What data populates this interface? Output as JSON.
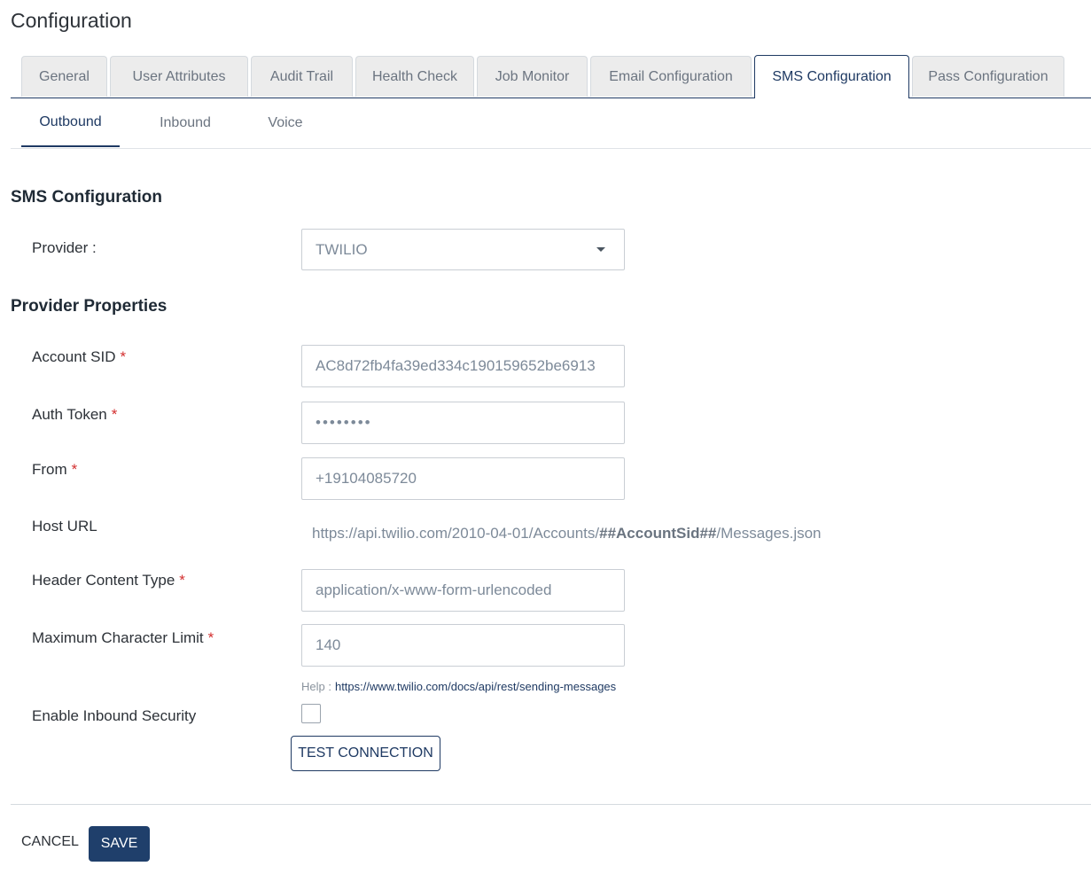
{
  "page": {
    "title": "Configuration"
  },
  "main_tabs": [
    {
      "label": "General"
    },
    {
      "label": "User Attributes"
    },
    {
      "label": "Audit Trail"
    },
    {
      "label": "Health Check"
    },
    {
      "label": "Job Monitor"
    },
    {
      "label": "Email Configuration"
    },
    {
      "label": "SMS Configuration"
    },
    {
      "label": "Pass Configuration"
    }
  ],
  "active_main_tab": "SMS Configuration",
  "sub_tabs": [
    {
      "label": "Outbound"
    },
    {
      "label": "Inbound"
    },
    {
      "label": "Voice"
    }
  ],
  "active_sub_tab": "Outbound",
  "sms_section": {
    "title": "SMS Configuration",
    "provider_label": "Provider :",
    "provider_value": "TWILIO"
  },
  "provider_properties": {
    "title": "Provider Properties",
    "account_sid": {
      "label": "Account SID",
      "value": "AC8d72fb4fa39ed334c190159652be6913"
    },
    "auth_token": {
      "label": "Auth Token",
      "value": "••••••••"
    },
    "from": {
      "label": "From",
      "value": "+19104085720"
    },
    "host_url": {
      "label": "Host URL",
      "prefix": "https://api.twilio.com/2010-04-01/Accounts/",
      "token": "##AccountSid##",
      "suffix": "/Messages.json"
    },
    "header_content_type": {
      "label": "Header Content Type",
      "value": "application/x-www-form-urlencoded"
    },
    "max_char_limit": {
      "label": "Maximum Character Limit",
      "value": "140"
    },
    "help": {
      "label": "Help :",
      "link": "https://www.twilio.com/docs/api/rest/sending-messages"
    },
    "enable_inbound_security": {
      "label": "Enable Inbound Security",
      "checked": false
    },
    "required_marker": "*"
  },
  "buttons": {
    "test_connection": "TEST CONNECTION",
    "cancel": "CANCEL",
    "save": "SAVE"
  },
  "colors": {
    "primary": "#1f3a63",
    "required": "#d32f2f",
    "tab_inactive_bg": "#ececec"
  }
}
